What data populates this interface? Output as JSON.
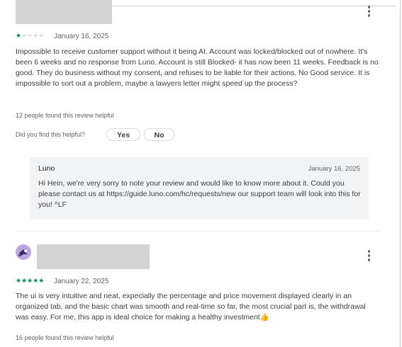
{
  "review1": {
    "stars": "★★★★★",
    "rating": 1,
    "date": "January 16, 2025",
    "text": "Impossible to receive customer support without it being AI. Account was locked/blocked out of nowhere. It's been 6 weeks and no response from Luno. Account is still Blocked- it has now been 11 weeks. Feedback is no good. They do business without my consent, and refuses to be liable for their actions. No Good service. It is impossible to sort out a problem, maybe a lawyers letter might speed up the process?",
    "helpful_count": "12 people found this review helpful",
    "helpful_question": "Did you find this helpful?",
    "yes_label": "Yes",
    "no_label": "No"
  },
  "reply": {
    "name": "Luno",
    "date": "January 16, 2025",
    "text": "Hi Hein, we're very sorry to note your review and would like to know more about it. Could you please contact us at https://guide.luno.com/hc/requests/new our support team will look into this for you! ^LF"
  },
  "review2": {
    "stars": "★★★★★",
    "rating": 5,
    "date": "January 22, 2025",
    "text": "The ui is very intuitive and neat, expecially the percentage and price movement displayed clearly in an organized tab, and the basic chart was smooth and real-time so far, the most crucial part is, the withdrawal was easy. For me, this app is ideal choice for making a healthy investment👍",
    "helpful_count": "16 people found this review helpful"
  },
  "colors": {
    "star": "#01875f",
    "star_off": "#dadce0",
    "reply_bg": "#f1f3f4"
  },
  "icons": {
    "menu": "more-vert-icon",
    "avatar": "user-avatar-icon"
  }
}
